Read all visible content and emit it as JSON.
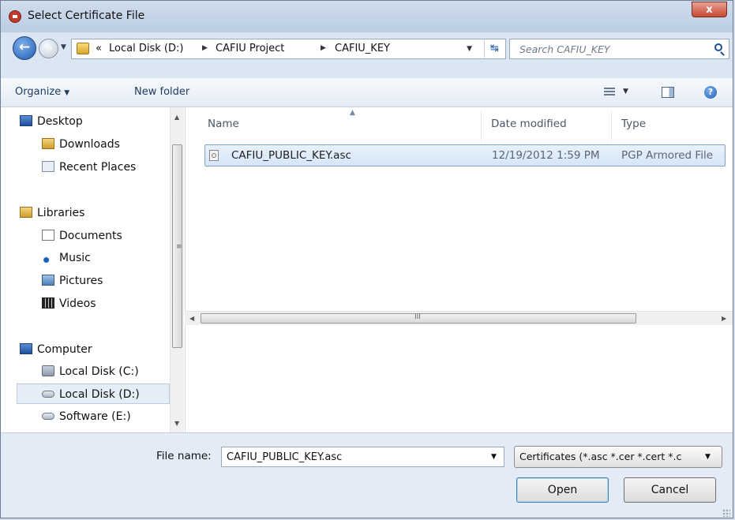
{
  "window": {
    "title": "Select Certificate File",
    "close_label": "x"
  },
  "nav": {
    "breadcrumbs": [
      "«",
      "Local Disk (D:)",
      "CAFIU Project",
      "CAFIU_KEY"
    ],
    "search_placeholder": "Search CAFIU_KEY"
  },
  "toolbar": {
    "organize_label": "Organize",
    "new_folder_label": "New folder"
  },
  "sidebar": {
    "items": [
      {
        "label": "Desktop",
        "icon": "desktop-icon"
      },
      {
        "label": "Downloads",
        "icon": "downloads-icon"
      },
      {
        "label": "Recent Places",
        "icon": "recent-places-icon"
      },
      {
        "label": "Libraries",
        "icon": "libraries-icon"
      },
      {
        "label": "Documents",
        "icon": "documents-icon"
      },
      {
        "label": "Music",
        "icon": "music-icon"
      },
      {
        "label": "Pictures",
        "icon": "pictures-icon"
      },
      {
        "label": "Videos",
        "icon": "videos-icon"
      },
      {
        "label": "Computer",
        "icon": "computer-icon"
      },
      {
        "label": "Local Disk (C:)",
        "icon": "drive-icon"
      },
      {
        "label": "Local Disk (D:)",
        "icon": "drive-icon",
        "selected": true
      },
      {
        "label": "Software (E:)",
        "icon": "drive-icon"
      }
    ]
  },
  "filelist": {
    "columns": [
      "Name",
      "Date modified",
      "Type"
    ],
    "rows": [
      {
        "name": "CAFIU_PUBLIC_KEY.asc",
        "date": "12/19/2012 1:59 PM",
        "type": "PGP Armored File"
      }
    ]
  },
  "footer": {
    "filename_label": "File name:",
    "filename_value": "CAFIU_PUBLIC_KEY.asc",
    "filter_value": "Certificates (*.asc *.cer *.cert *.c",
    "open_label": "Open",
    "cancel_label": "Cancel"
  },
  "scrollbars": {
    "horizontal_grip": "III",
    "vertical_grip": "≡"
  }
}
